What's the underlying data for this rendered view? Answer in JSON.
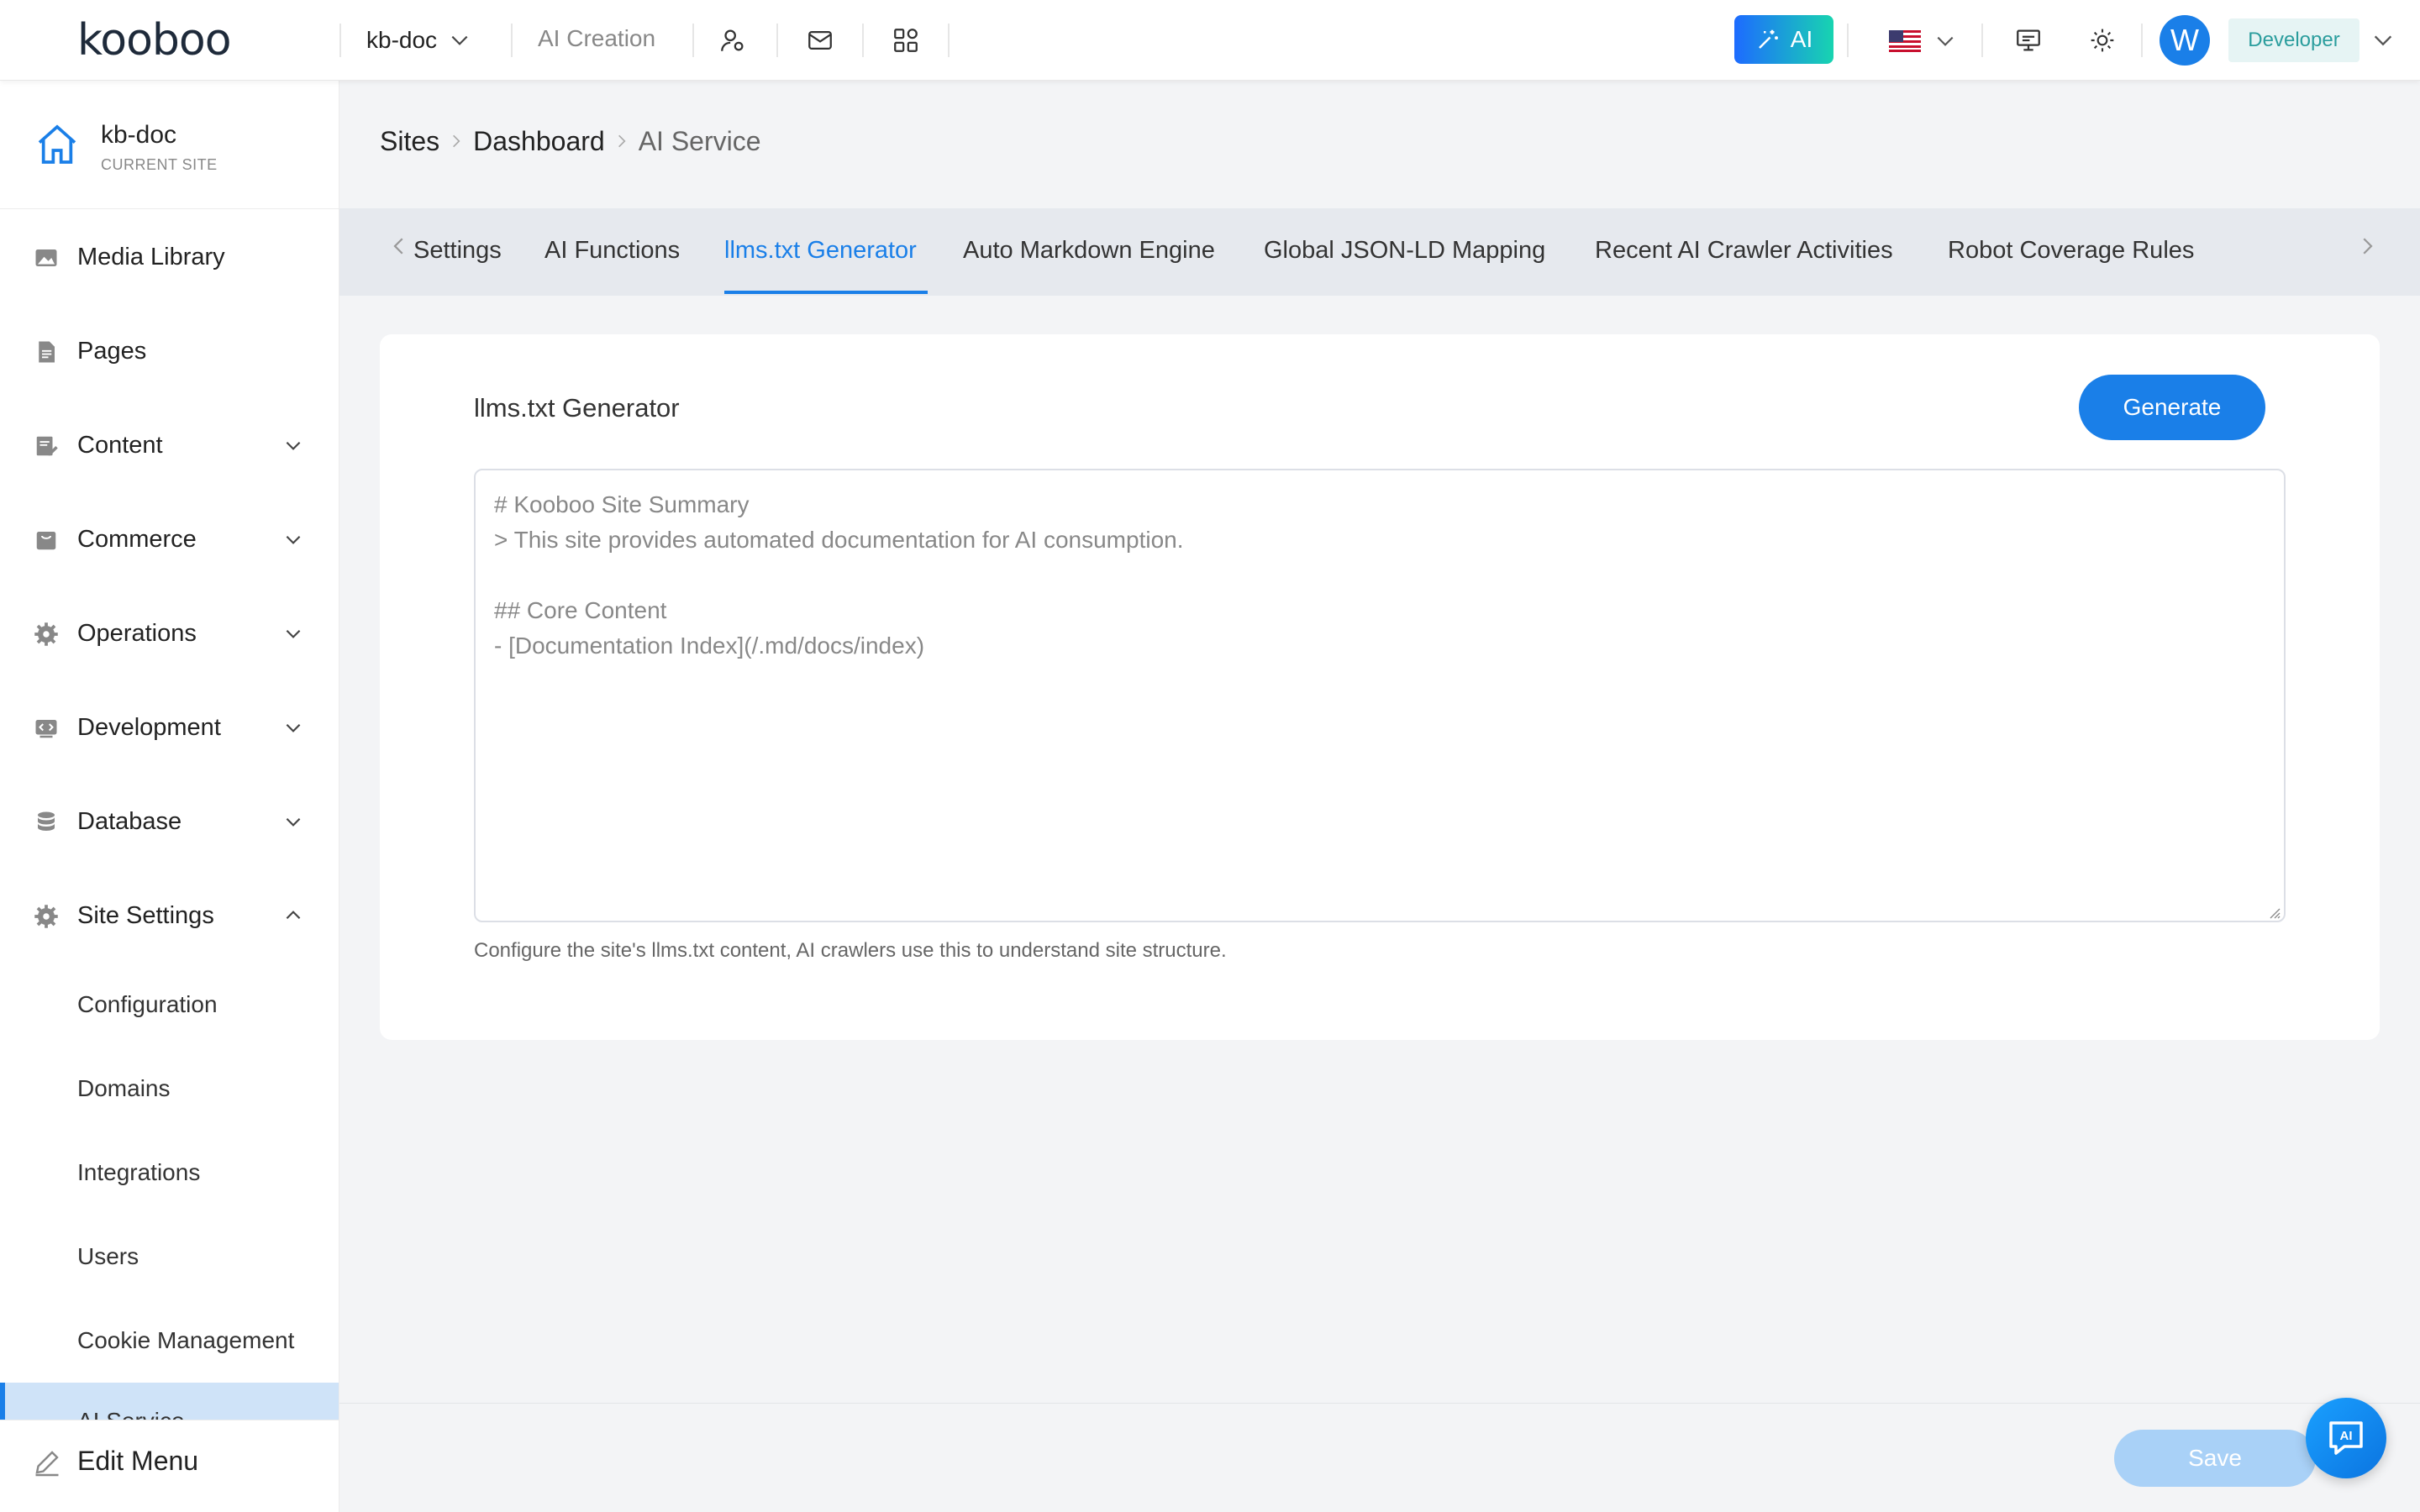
{
  "topbar": {
    "logo": "kooboo",
    "site_name": "kb-doc",
    "ai_creation": "AI Creation",
    "ai_button": "AI",
    "avatar_letter": "W",
    "role": "Developer"
  },
  "sidebar": {
    "current_site": {
      "name": "kb-doc",
      "caption": "CURRENT SITE"
    },
    "items": [
      {
        "label": "Media Library",
        "icon": "image-icon"
      },
      {
        "label": "Pages",
        "icon": "document-icon"
      },
      {
        "label": "Content",
        "icon": "edit-note-icon",
        "expandable": true
      },
      {
        "label": "Commerce",
        "icon": "shopping-bag-icon",
        "expandable": true
      },
      {
        "label": "Operations",
        "icon": "gear-icon",
        "expandable": true
      },
      {
        "label": "Development",
        "icon": "code-icon",
        "expandable": true
      },
      {
        "label": "Database",
        "icon": "database-icon",
        "expandable": true
      },
      {
        "label": "Site Settings",
        "icon": "gear-icon",
        "expandable": true,
        "expanded": true
      }
    ],
    "sub_items": [
      "Configuration",
      "Domains",
      "Integrations",
      "Users",
      "Cookie Management",
      "AI Service"
    ],
    "edit_menu": "Edit Menu"
  },
  "breadcrumb": [
    "Sites",
    "Dashboard",
    "AI Service"
  ],
  "tabs": [
    "Settings",
    "AI Functions",
    "llms.txt Generator",
    "Auto Markdown Engine",
    "Global JSON-LD Mapping",
    "Recent AI Crawler Activities",
    "Robot Coverage Rules"
  ],
  "active_tab": "llms.txt Generator",
  "generator": {
    "title": "llms.txt Generator",
    "generate_label": "Generate",
    "content": "# Kooboo Site Summary\n> This site provides automated documentation for AI consumption.\n\n## Core Content\n- [Documentation Index](/.md/docs/index)",
    "help": "Configure the site's llms.txt content, AI crawlers use this to understand site structure."
  },
  "footer": {
    "save_label": "Save",
    "chat_label": "AI"
  },
  "colors": {
    "accent": "#1a7fe8",
    "ai_gradient_start": "#1d6bff",
    "ai_gradient_end": "#18d4b0",
    "role_badge_text": "#2a9d9d"
  }
}
